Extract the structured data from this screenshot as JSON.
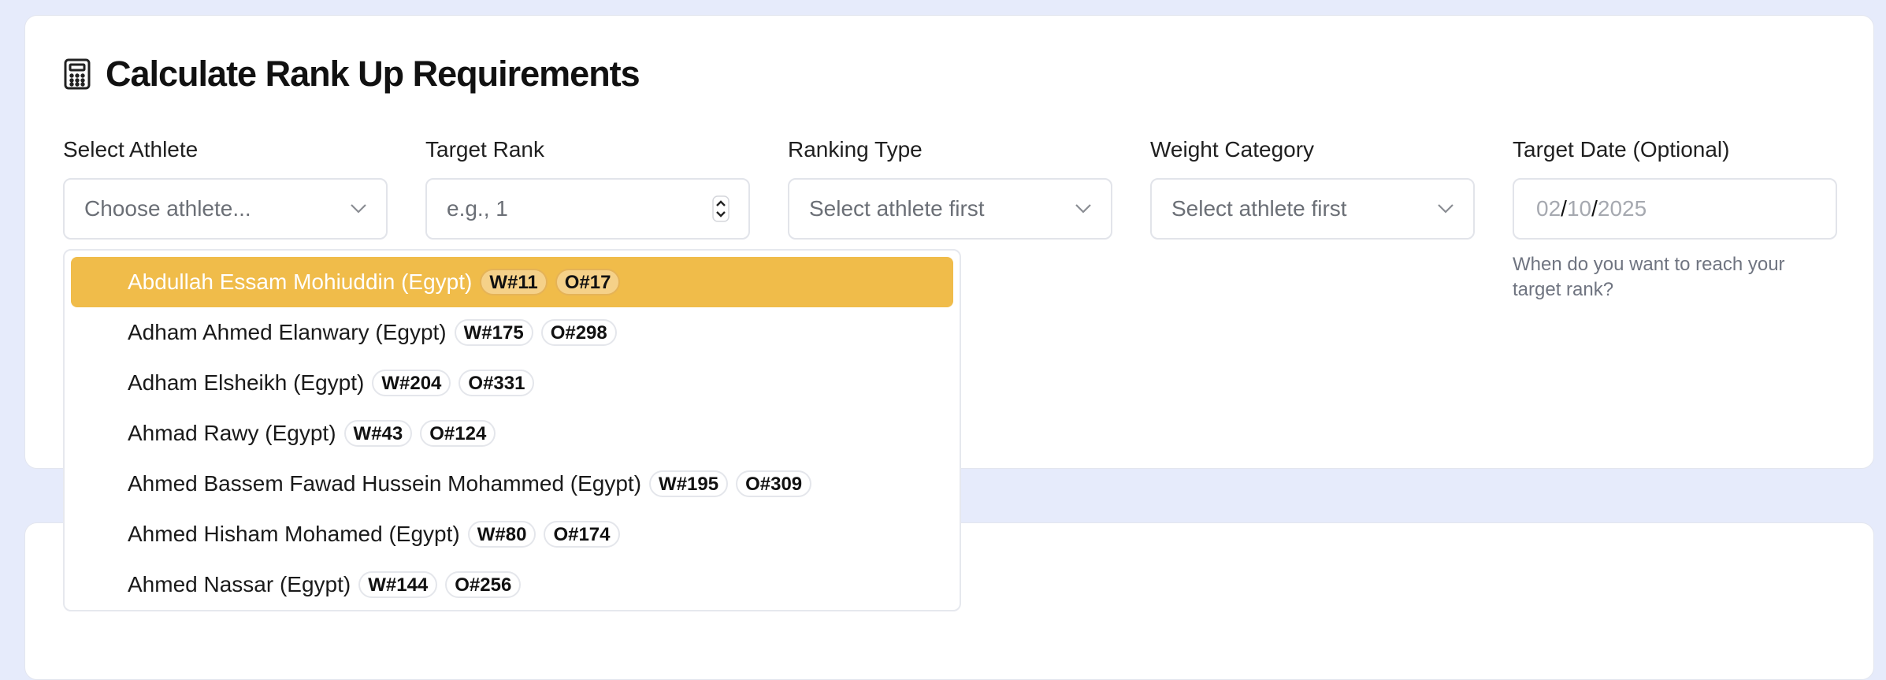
{
  "header": {
    "title": "Calculate Rank Up Requirements",
    "icon": "calculator-icon"
  },
  "fields": {
    "athlete": {
      "label": "Select Athlete",
      "placeholder": "Choose athlete..."
    },
    "target_rank": {
      "label": "Target Rank",
      "placeholder": "e.g., 1"
    },
    "ranking_type": {
      "label": "Ranking Type",
      "placeholder": "Select athlete first"
    },
    "weight_category": {
      "label": "Weight Category",
      "placeholder": "Select athlete first"
    },
    "target_date": {
      "label": "Target Date (Optional)",
      "month": "02",
      "day": "10",
      "year": "2025",
      "separator": "/",
      "hint": "When do you want to reach your target rank?"
    }
  },
  "dropdown": {
    "options": [
      {
        "name": "Abdullah Essam Mohiuddin (Egypt)",
        "w": "W#11",
        "o": "O#17",
        "highlighted": true
      },
      {
        "name": "Adham Ahmed Elanwary (Egypt)",
        "w": "W#175",
        "o": "O#298"
      },
      {
        "name": "Adham Elsheikh (Egypt)",
        "w": "W#204",
        "o": "O#331"
      },
      {
        "name": "Ahmad Rawy (Egypt)",
        "w": "W#43",
        "o": "O#124"
      },
      {
        "name": "Ahmed Bassem Fawad Hussein Mohammed (Egypt)",
        "w": "W#195",
        "o": "O#309"
      },
      {
        "name": "Ahmed Hisham Mohamed (Egypt)",
        "w": "W#80",
        "o": "O#174"
      },
      {
        "name": "Ahmed Nassar (Egypt)",
        "w": "W#144",
        "o": "O#256"
      }
    ]
  },
  "colors": {
    "background": "#e6ebfb",
    "highlight": "#f0bc4a",
    "card": "#ffffff"
  }
}
